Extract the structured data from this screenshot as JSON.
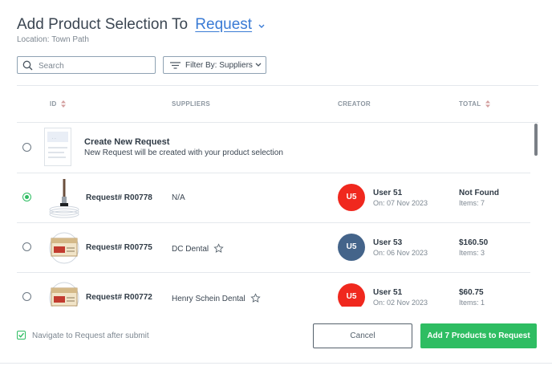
{
  "header": {
    "title_prefix": "Add Product Selection To",
    "title_link": "Request",
    "location_label": "Location:",
    "location_value": "Town Path"
  },
  "toolbar": {
    "search_placeholder": "Search",
    "filter_label": "Filter By: Suppliers"
  },
  "table": {
    "columns": [
      "ID",
      "SUPPLIERS",
      "CREATOR",
      "TOTAL"
    ],
    "create_new": {
      "title": "Create New Request",
      "subtitle": "New Request will be created with your product selection"
    },
    "rows": [
      {
        "id": "Request# R00778",
        "supplier": "N/A",
        "creator_initials": "U5",
        "creator_name": "User 51",
        "date": "On: 07 Nov 2023",
        "total": "Not Found",
        "items": "Items: 7",
        "avatar_color": "#f0281e",
        "selected": true
      },
      {
        "id": "Request# R00775",
        "supplier": "DC Dental",
        "creator_initials": "U5",
        "creator_name": "User 53",
        "date": "On: 06 Nov 2023",
        "total": "$160.50",
        "items": "Items: 3",
        "avatar_color": "#44648a",
        "selected": false
      },
      {
        "id": "Request# R00772",
        "supplier": "Henry Schein Dental",
        "creator_initials": "U5",
        "creator_name": "User 51",
        "date": "On: 02 Nov 2023",
        "total": "$60.75",
        "items": "Items: 1",
        "avatar_color": "#f0281e",
        "selected": false
      }
    ]
  },
  "footer": {
    "navigate_label": "Navigate to Request after submit",
    "navigate_checked": true,
    "cancel_label": "Cancel",
    "submit_label": "Add 7 Products to Request"
  },
  "colors": {
    "accent_green": "#2ebd62",
    "link_blue": "#3a7bd5",
    "avatar_red": "#f0281e",
    "avatar_blue": "#44648a"
  },
  "icons": [
    "chevron-down-icon",
    "search-icon",
    "filter-icon",
    "sort-icon",
    "star-icon",
    "check-icon"
  ]
}
